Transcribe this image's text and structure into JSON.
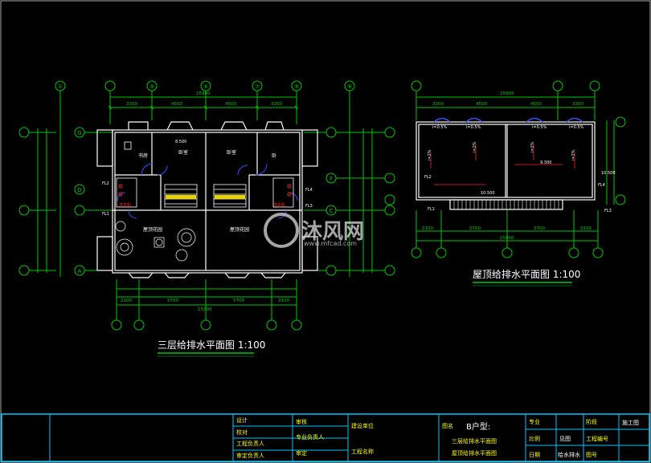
{
  "drawings": {
    "floor3": {
      "title": "三层给排水平面图 1:100",
      "overall_width": "15900",
      "top_dims": [
        "3300",
        "4500",
        "4500",
        "3300"
      ],
      "bottom_dims": [
        "2100",
        "5700",
        "5700",
        "2100"
      ],
      "rooms": [
        "书房",
        "卧室",
        "卧室",
        "卧",
        "屋顶花园",
        "屋顶花园"
      ],
      "col_labels": [
        "①",
        "③",
        "⑤",
        "⑦",
        "⑨",
        "⑨"
      ],
      "row_labels": [
        "G",
        "F",
        "D",
        "C",
        "A"
      ],
      "fixtures": [
        "FL1",
        "FL2",
        "FL3",
        "FL4",
        "洗衣机",
        "洗衣机"
      ],
      "elevation": "8.500"
    },
    "roof": {
      "title": "屋顶给排水平面图 1:100",
      "overall_width": "15900",
      "top_dims": [
        "3300",
        "4500",
        "4500",
        "3300"
      ],
      "bottom_dims": [
        "2100",
        "5700",
        "5700",
        "2100"
      ],
      "slope_labels": [
        "i=0.5%",
        "i=0.5%",
        "i=0.5%",
        "i=0.5%",
        "i=2%",
        "i=2%",
        "i=2%",
        "i=2%"
      ],
      "elevations": [
        "9.300",
        "10.500",
        "10.500"
      ],
      "fixtures": [
        "FL1",
        "FL2",
        "FL3",
        "FL4"
      ]
    }
  },
  "watermark": {
    "brand": "沐风网",
    "url": "www.mfcad.com"
  },
  "title_block": {
    "col1": [
      "设计",
      "校对",
      "工程负责人",
      "审定负责人"
    ],
    "col2": [
      "审核",
      "专业负责人",
      "审定"
    ],
    "col3": [
      "建设单位",
      "工程名称"
    ],
    "drawing_label": "图名",
    "unit_type": "B户型:",
    "drawing_names": [
      "三层给排水平面图",
      "屋顶给排水平面图"
    ],
    "stage_label": "阶段",
    "stage": "施工图",
    "discipline_label": "专业",
    "discipline": "给水排水",
    "date_label": "日期",
    "scale_label": "比例",
    "scale": "见图",
    "project_no_label": "工程编号",
    "drawing_no_label": "图号"
  }
}
